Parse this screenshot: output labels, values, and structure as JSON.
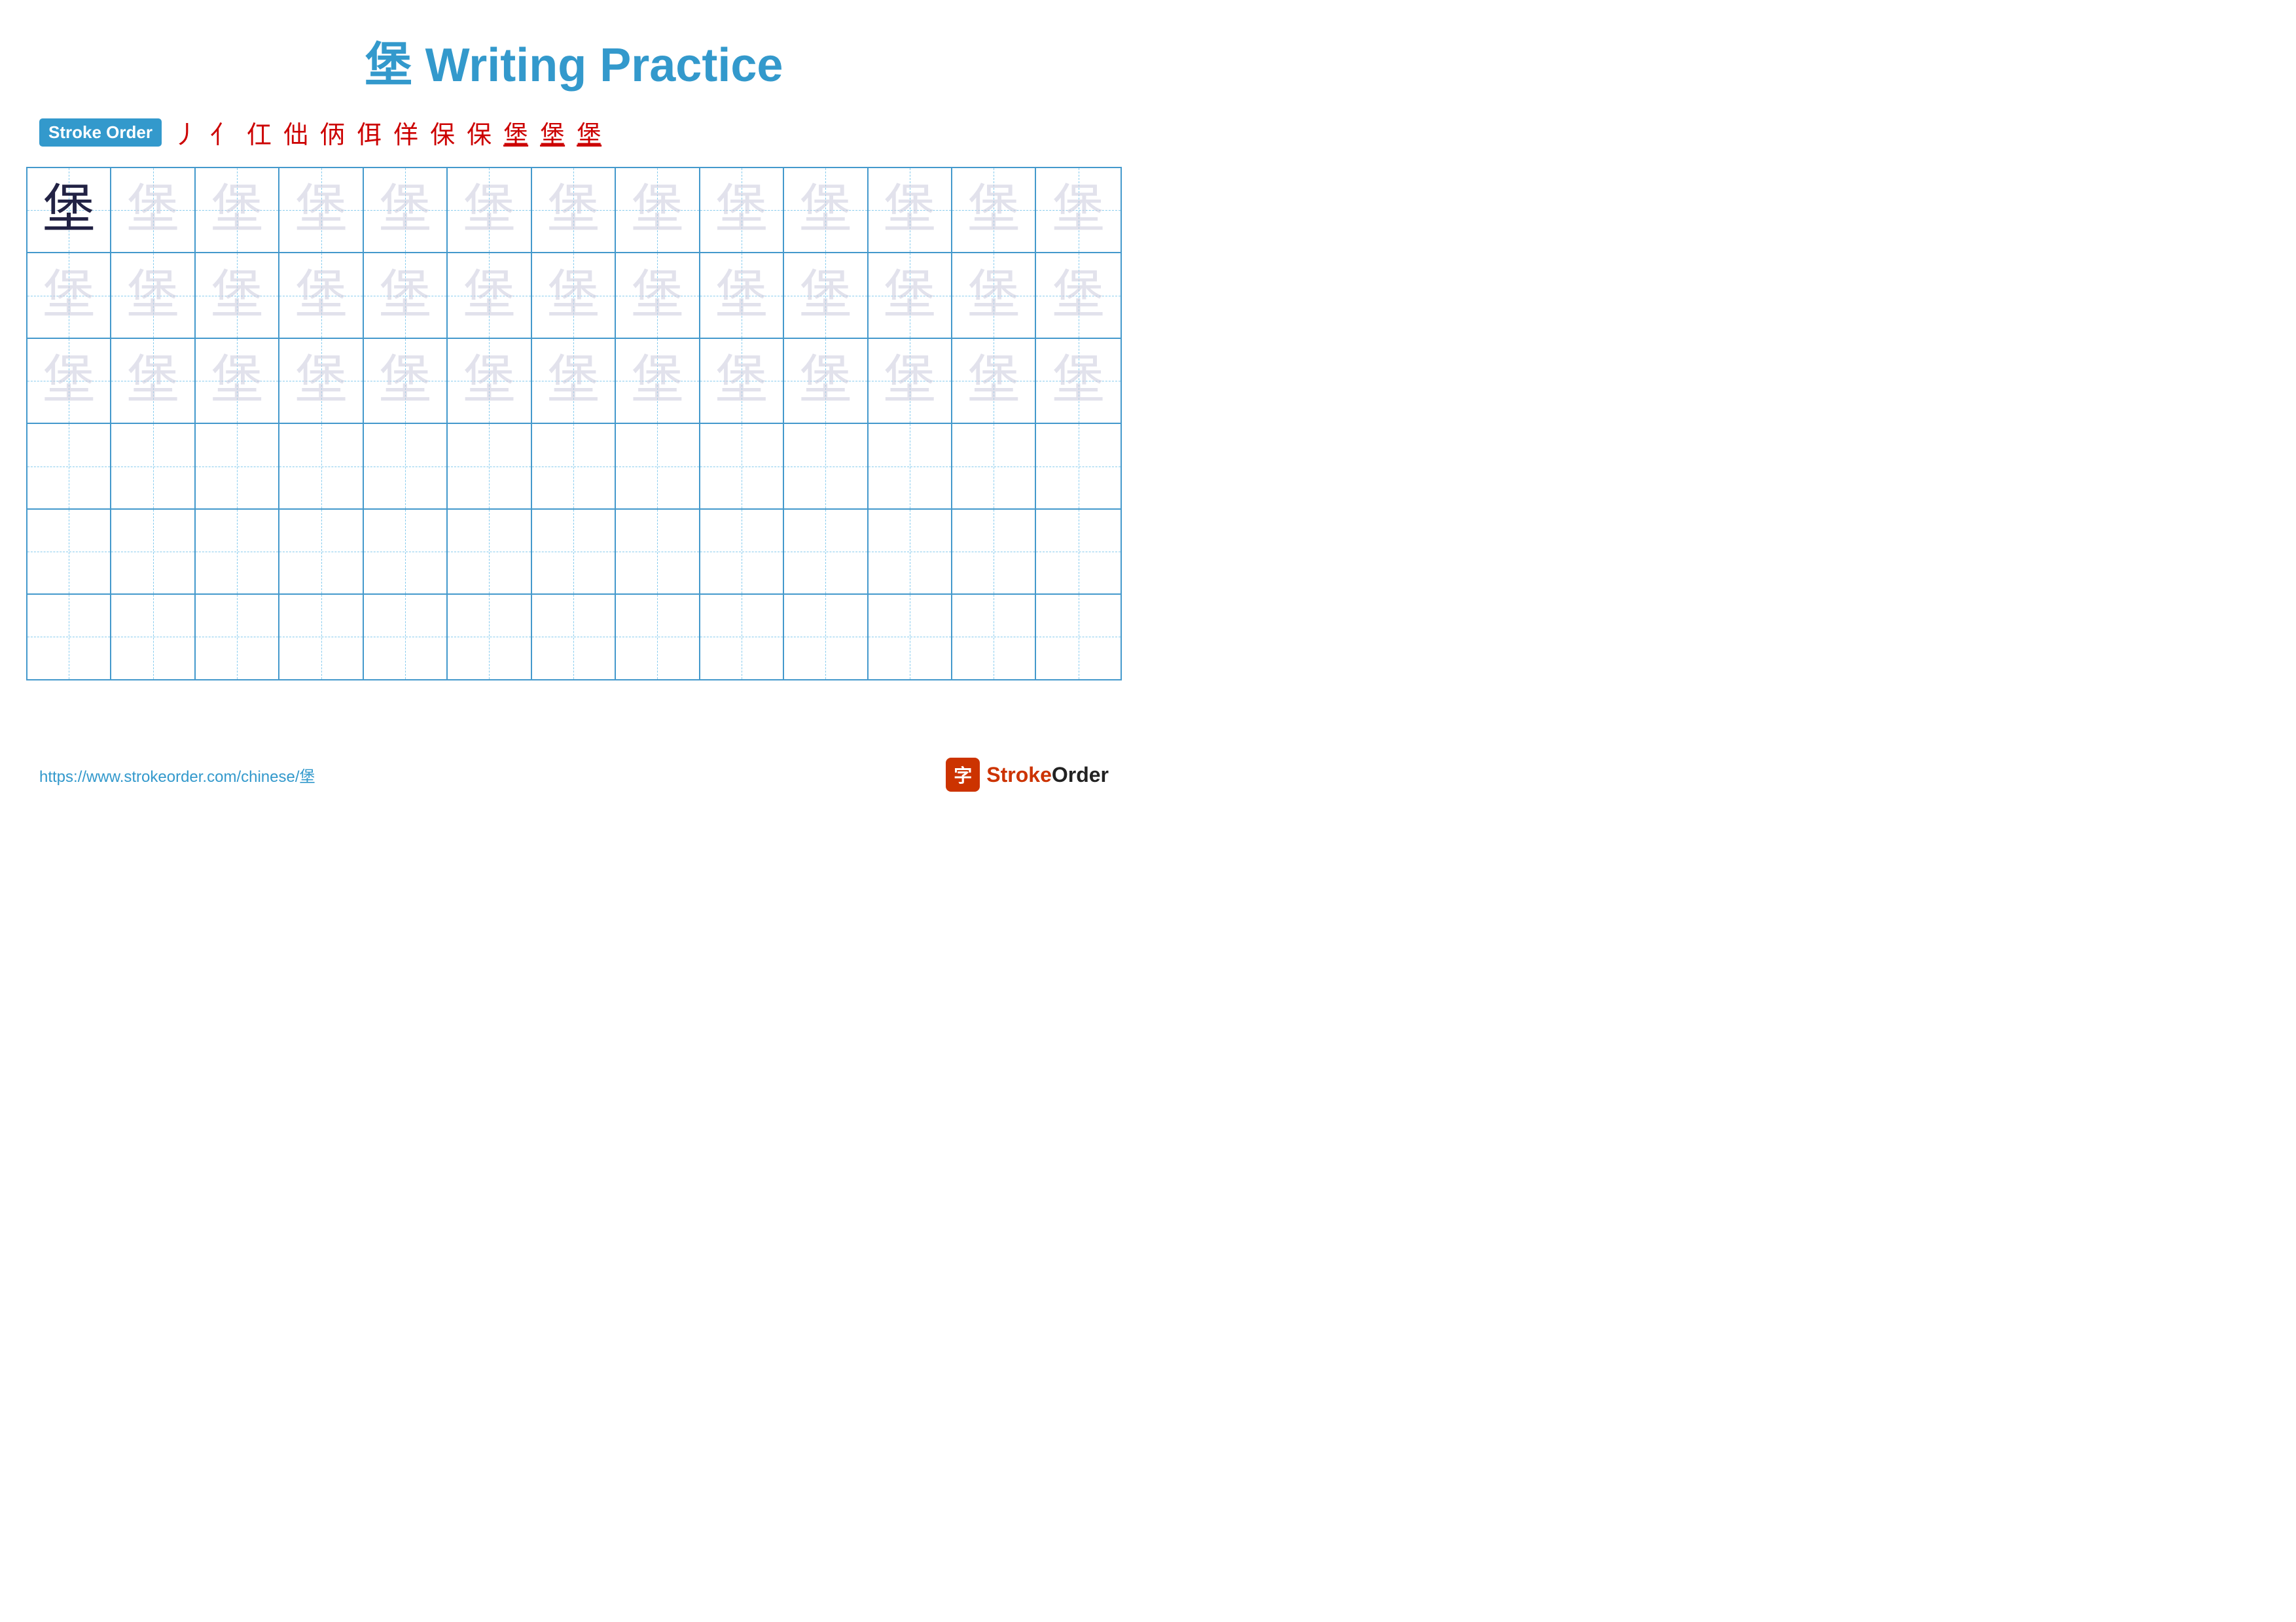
{
  "title": {
    "chinese_char": "堡",
    "label": "Writing Practice"
  },
  "stroke_order": {
    "badge_label": "Stroke Order",
    "strokes": [
      "丿",
      "亻",
      "仜",
      "仿",
      "仿",
      "佴",
      "佯",
      "保",
      "保",
      "堡̲",
      "堡̲",
      "堡"
    ]
  },
  "grid": {
    "rows": 6,
    "cols": 13,
    "char": "堡",
    "practice_char": "堡"
  },
  "footer": {
    "url": "https://www.strokeorder.com/chinese/堡",
    "brand_icon": "字",
    "brand_name": "StrokeOrder"
  }
}
